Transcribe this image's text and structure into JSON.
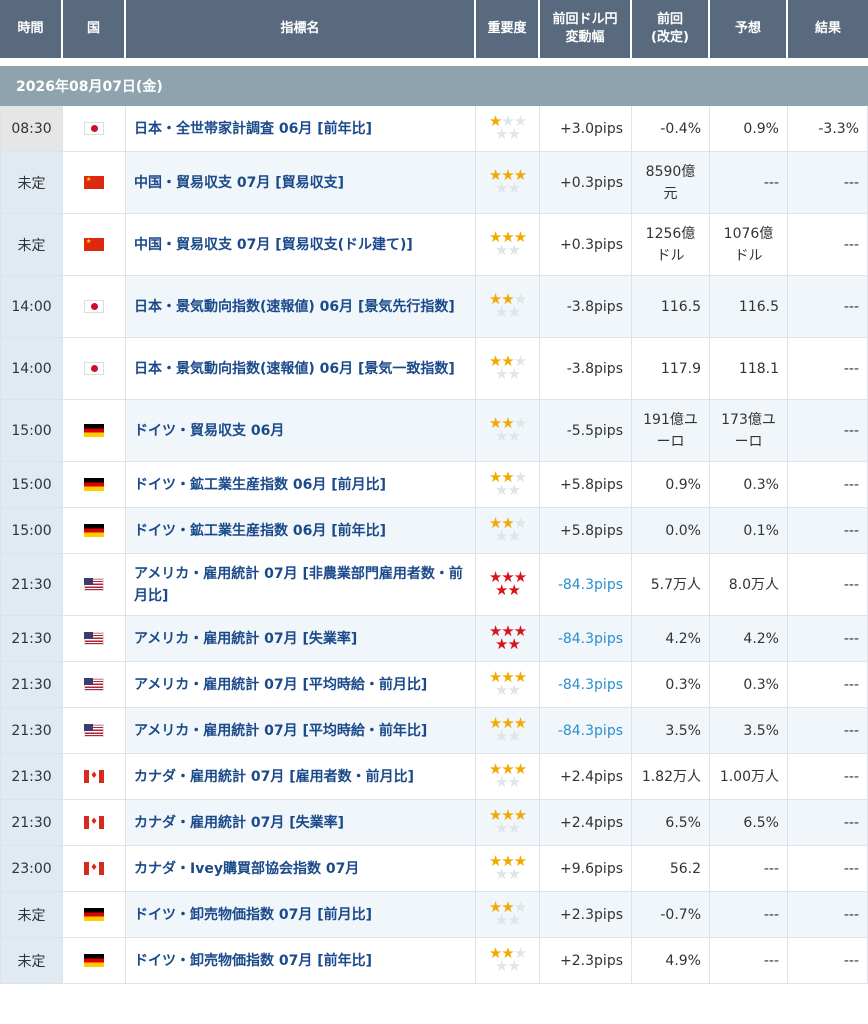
{
  "header": {
    "time": "時間",
    "country": "国",
    "indicator": "指標名",
    "importance": "重要度",
    "pips_line1": "前回ドル円",
    "pips_line2": "変動幅",
    "prev_line1": "前回",
    "prev_line2": "(改定)",
    "forecast": "予想",
    "result": "結果"
  },
  "date_label": "2026年08月07日(金)",
  "icons": {
    "star_filled": "star-filled-icon",
    "star_empty": "star-empty-icon",
    "flags": [
      "japan-flag",
      "china-flag",
      "germany-flag",
      "usa-flag",
      "canada-flag"
    ]
  },
  "colors": {
    "header_bg": "#5a6a7e",
    "date_bg": "#8fa3af",
    "link": "#1a4a8a",
    "neg_pips": "#2a8fcf",
    "star_gold": "#f2a900",
    "star_red": "#d8141c"
  },
  "rows": [
    {
      "time": "08:30",
      "country": "jp",
      "name": "日本・全世帯家計調査 06月 [前年比]",
      "stars": 1,
      "red": false,
      "pips": "+3.0pips",
      "prev1": "-0.4%",
      "prev2": "",
      "fc1": "0.9%",
      "fc2": "",
      "result": "-3.3%"
    },
    {
      "time": "未定",
      "country": "cn",
      "name": "中国・貿易収支 07月 [貿易収支]",
      "stars": 3,
      "red": false,
      "pips": "+0.3pips",
      "prev1": "8590億",
      "prev2": "元",
      "fc1": "---",
      "fc2": "",
      "result": "---"
    },
    {
      "time": "未定",
      "country": "cn",
      "name": "中国・貿易収支 07月 [貿易収支(ドル建て)]",
      "stars": 3,
      "red": false,
      "pips": "+0.3pips",
      "prev1": "1256億",
      "prev2": "ドル",
      "fc1": "1076億",
      "fc2": "ドル",
      "result": "---"
    },
    {
      "time": "14:00",
      "country": "jp",
      "name": "日本・景気動向指数(速報値) 06月 [景気先行指数]",
      "stars": 2,
      "red": false,
      "pips": "-3.8pips",
      "prev1": "116.5",
      "prev2": "",
      "fc1": "116.5",
      "fc2": "",
      "result": "---"
    },
    {
      "time": "14:00",
      "country": "jp",
      "name": "日本・景気動向指数(速報値) 06月 [景気一致指数]",
      "stars": 2,
      "red": false,
      "pips": "-3.8pips",
      "prev1": "117.9",
      "prev2": "",
      "fc1": "118.1",
      "fc2": "",
      "result": "---"
    },
    {
      "time": "15:00",
      "country": "de",
      "name": "ドイツ・貿易収支 06月",
      "stars": 2,
      "red": false,
      "pips": "-5.5pips",
      "prev1": "191億ユ",
      "prev2": "ーロ",
      "fc1": "173億ユ",
      "fc2": "ーロ",
      "result": "---"
    },
    {
      "time": "15:00",
      "country": "de",
      "name": "ドイツ・鉱工業生産指数 06月 [前月比]",
      "stars": 2,
      "red": false,
      "pips": "+5.8pips",
      "prev1": "0.9%",
      "prev2": "",
      "fc1": "0.3%",
      "fc2": "",
      "result": "---"
    },
    {
      "time": "15:00",
      "country": "de",
      "name": "ドイツ・鉱工業生産指数 06月 [前年比]",
      "stars": 2,
      "red": false,
      "pips": "+5.8pips",
      "prev1": "0.0%",
      "prev2": "",
      "fc1": "0.1%",
      "fc2": "",
      "result": "---"
    },
    {
      "time": "21:30",
      "country": "us",
      "name": "アメリカ・雇用統計 07月 [非農業部門雇用者数・前月比]",
      "stars": 5,
      "red": true,
      "pips": "-84.3pips",
      "prev1": "5.7万人",
      "prev2": "",
      "fc1": "8.0万人",
      "fc2": "",
      "result": "---"
    },
    {
      "time": "21:30",
      "country": "us",
      "name": "アメリカ・雇用統計 07月 [失業率]",
      "stars": 5,
      "red": true,
      "pips": "-84.3pips",
      "prev1": "4.2%",
      "prev2": "",
      "fc1": "4.2%",
      "fc2": "",
      "result": "---"
    },
    {
      "time": "21:30",
      "country": "us",
      "name": "アメリカ・雇用統計 07月 [平均時給・前月比]",
      "stars": 3,
      "red": false,
      "pips": "-84.3pips",
      "prev1": "0.3%",
      "prev2": "",
      "fc1": "0.3%",
      "fc2": "",
      "result": "---"
    },
    {
      "time": "21:30",
      "country": "us",
      "name": "アメリカ・雇用統計 07月 [平均時給・前年比]",
      "stars": 3,
      "red": false,
      "pips": "-84.3pips",
      "prev1": "3.5%",
      "prev2": "",
      "fc1": "3.5%",
      "fc2": "",
      "result": "---"
    },
    {
      "time": "21:30",
      "country": "ca",
      "name": "カナダ・雇用統計 07月 [雇用者数・前月比]",
      "stars": 3,
      "red": false,
      "pips": "+2.4pips",
      "prev1": "1.82万人",
      "prev2": "",
      "fc1": "1.00万人",
      "fc2": "",
      "result": "---"
    },
    {
      "time": "21:30",
      "country": "ca",
      "name": "カナダ・雇用統計 07月 [失業率]",
      "stars": 3,
      "red": false,
      "pips": "+2.4pips",
      "prev1": "6.5%",
      "prev2": "",
      "fc1": "6.5%",
      "fc2": "",
      "result": "---"
    },
    {
      "time": "23:00",
      "country": "ca",
      "name": "カナダ・Ivey購買部協会指数 07月",
      "stars": 3,
      "red": false,
      "pips": "+9.6pips",
      "prev1": "56.2",
      "prev2": "",
      "fc1": "---",
      "fc2": "",
      "result": "---"
    },
    {
      "time": "未定",
      "country": "de",
      "name": "ドイツ・卸売物価指数 07月 [前月比]",
      "stars": 2,
      "red": false,
      "pips": "+2.3pips",
      "prev1": "-0.7%",
      "prev2": "",
      "fc1": "---",
      "fc2": "",
      "result": "---"
    },
    {
      "time": "未定",
      "country": "de",
      "name": "ドイツ・卸売物価指数 07月 [前年比]",
      "stars": 2,
      "red": false,
      "pips": "+2.3pips",
      "prev1": "4.9%",
      "prev2": "",
      "fc1": "---",
      "fc2": "",
      "result": "---"
    }
  ]
}
